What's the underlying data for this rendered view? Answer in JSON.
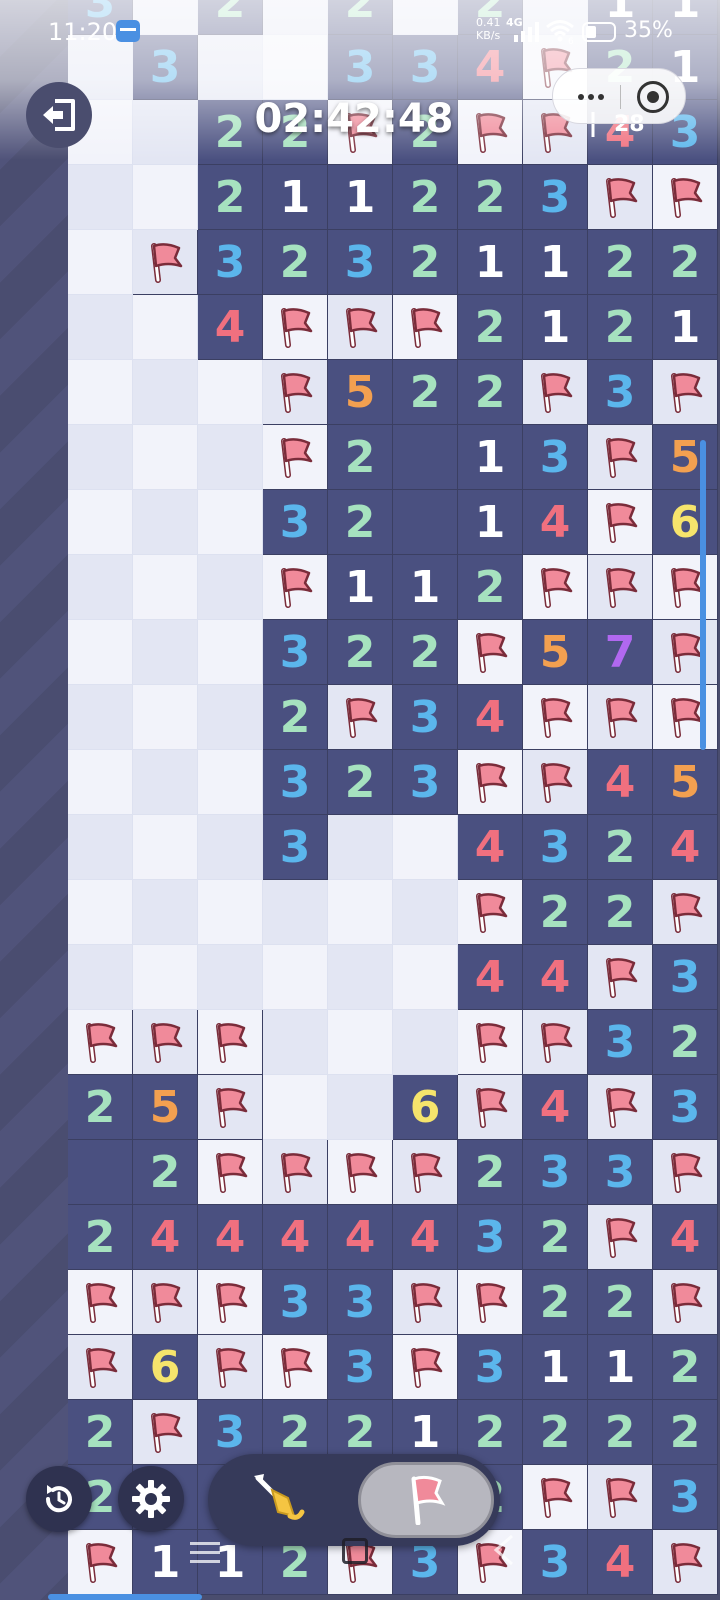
{
  "status_bar": {
    "time": "11:20",
    "net_speed_value": "0.41",
    "net_speed_unit": "KB/s",
    "network_type": "4G",
    "wifi_badge": "6",
    "battery": "35%"
  },
  "game": {
    "timer": "02:42:48",
    "flag_count": "28"
  },
  "icons": {
    "exit": "exit-icon",
    "restart": "restart-icon",
    "settings": "gear-icon",
    "dig": "shovel-icon",
    "flag": "flag-icon"
  },
  "colors": {
    "revealed_cell": "#4a5080",
    "hidden_light": "#f2f3fa",
    "hidden_dark": "#e3e6f3",
    "flag": "#f08a9a",
    "num": {
      "1": "#ffffff",
      "2": "#a6e2bf",
      "3": "#5bb6ec",
      "4": "#f0707f",
      "5": "#f3a050",
      "6": "#f6e46c",
      "7": "#b168f0"
    }
  },
  "board": {
    "columns": 10,
    "rows": [
      [
        "3",
        "",
        "2",
        "",
        "2",
        "",
        "2",
        "",
        "1",
        "1"
      ],
      [
        "",
        "3",
        "",
        "",
        "3",
        "3",
        "4",
        "F",
        "2",
        "1"
      ],
      [
        "",
        "",
        "2",
        "2",
        "F",
        "2",
        "F",
        "F",
        "4",
        "3"
      ],
      [
        "",
        "",
        "2",
        "1",
        "1",
        "2",
        "2",
        "3",
        "F",
        "F"
      ],
      [
        "",
        "F",
        "3",
        "2",
        "3",
        "2",
        "1",
        "1",
        "2",
        "2"
      ],
      [
        "",
        "",
        "4",
        "F",
        "F",
        "F",
        "2",
        "1",
        "2",
        "1"
      ],
      [
        "",
        "",
        "",
        "F",
        "5",
        "2",
        "2",
        "F",
        "3",
        "F"
      ],
      [
        "",
        "",
        "",
        "F",
        "2",
        ".",
        "1",
        "3",
        "F",
        "5"
      ],
      [
        "",
        "",
        "",
        "3",
        "2",
        ".",
        "1",
        "4",
        "F",
        "6"
      ],
      [
        "",
        "",
        "",
        "F",
        "1",
        "1",
        "2",
        "F",
        "F",
        "F"
      ],
      [
        "",
        "",
        "",
        "3",
        "2",
        "2",
        "F",
        "5",
        "7",
        "F"
      ],
      [
        "",
        "",
        "",
        "2",
        "F",
        "3",
        "4",
        "F",
        "F",
        "F"
      ],
      [
        "",
        "",
        "",
        "3",
        "2",
        "3",
        "F",
        "F",
        "4",
        "5"
      ],
      [
        "",
        "",
        "",
        "3",
        "",
        "",
        "4",
        "3",
        "2",
        "4"
      ],
      [
        "",
        "",
        "",
        "",
        "",
        "",
        "F",
        "2",
        "2",
        "F"
      ],
      [
        "",
        "",
        "",
        "",
        "",
        "",
        "4",
        "4",
        "F",
        "3"
      ],
      [
        "F",
        "F",
        "F",
        "",
        "",
        "",
        "F",
        "F",
        "3",
        "2"
      ],
      [
        "2",
        "5",
        "F",
        "",
        "",
        "6",
        "F",
        "4",
        "F",
        "3"
      ],
      [
        ".",
        "2",
        "F",
        "F",
        "F",
        "F",
        "2",
        "3",
        "3",
        "F"
      ],
      [
        "2",
        "4",
        "4",
        "4",
        "4",
        "4",
        "3",
        "2",
        "F",
        "4"
      ],
      [
        "F",
        "F",
        "F",
        "3",
        "3",
        "F",
        "F",
        "2",
        "2",
        "F"
      ],
      [
        "F",
        "6",
        "F",
        "F",
        "3",
        "F",
        "3",
        "1",
        "1",
        "2"
      ],
      [
        "2",
        "F",
        "3",
        "2",
        "2",
        "1",
        "2",
        "2",
        "2",
        "2"
      ],
      [
        "2",
        "3",
        "1",
        "F",
        "F",
        "F",
        "2",
        "F",
        "F",
        "3"
      ],
      [
        "F",
        "1",
        "1",
        "2",
        "F",
        "3",
        "F",
        "3",
        "4",
        "F"
      ]
    ]
  }
}
